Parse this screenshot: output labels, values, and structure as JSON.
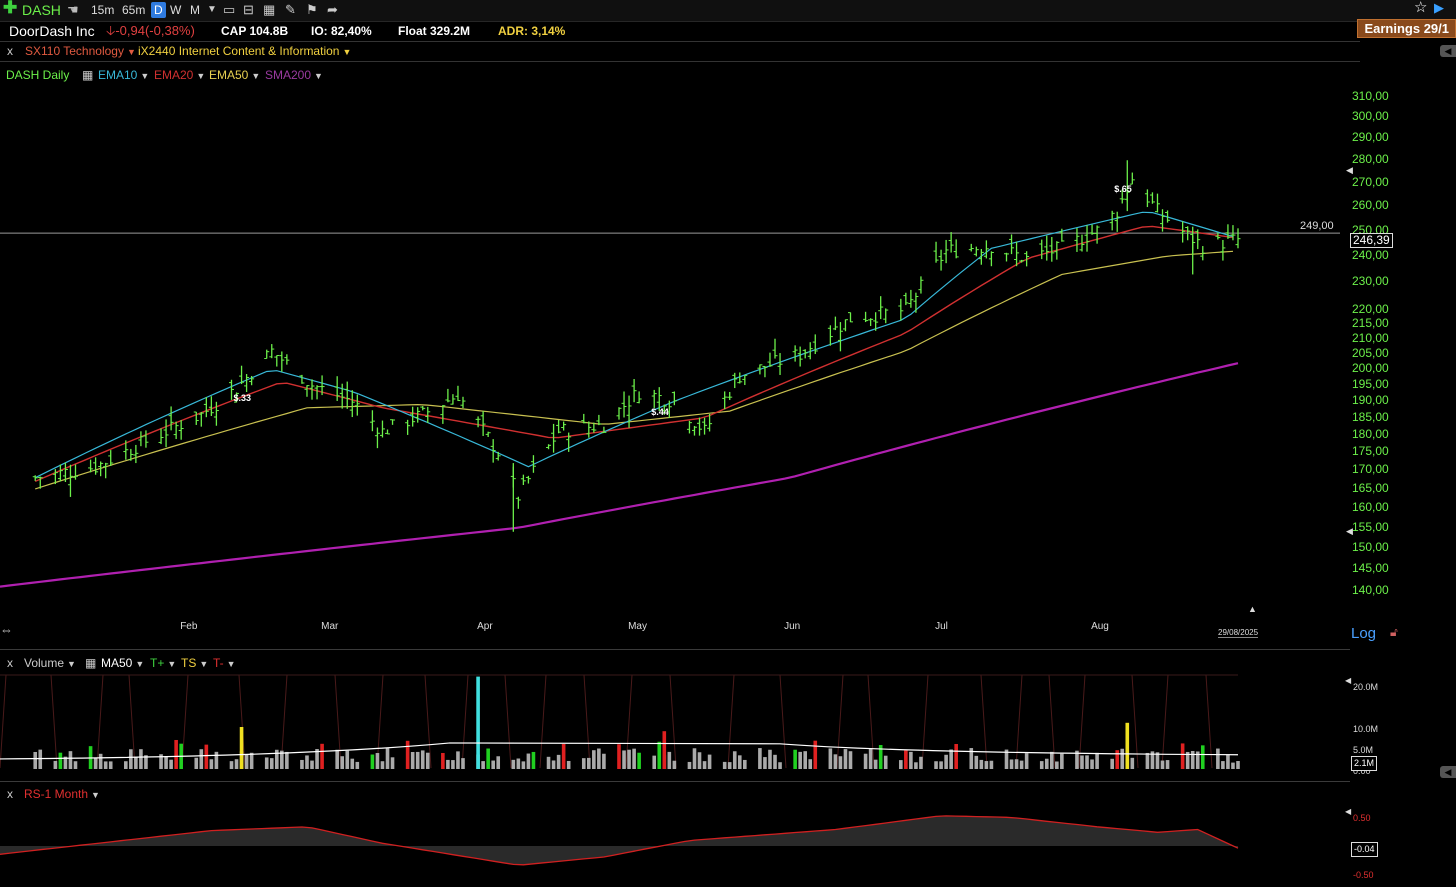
{
  "toolbar": {
    "symbol": "DASH",
    "intervals": [
      "15m",
      "65m",
      "D",
      "W",
      "M"
    ],
    "earnings": "Earnings 29/1"
  },
  "info": {
    "name": "DoorDash Inc",
    "change": "-0,94(-0,38%)",
    "cap": "CAP 104.8B",
    "io": "IO: 82,40%",
    "float": "Float 329.2M",
    "adr": "ADR: 3,14%"
  },
  "sector": {
    "close": "x",
    "sector": "SX110 Technology",
    "industry": "iX2440 Internet Content & Information"
  },
  "indicators": {
    "main": "DASH Daily",
    "ema10": "EMA10",
    "ema20": "EMA20",
    "ema50": "EMA50",
    "sma200": "SMA200"
  },
  "colors": {
    "bars": "#6cf04a",
    "ema10": "#38b8d8",
    "ema20": "#d03030",
    "ema50": "#c8c050",
    "sma200": "#b020b0",
    "rs": "#d02020"
  },
  "volume_panel": {
    "close": "x",
    "label": "Volume",
    "ma": "MA50",
    "tplus": "T+",
    "ts": "TS",
    "tminus": "T-",
    "current": "2.1M",
    "axis": [
      "20.0M",
      "10.0M",
      "5.0M",
      "0.00"
    ]
  },
  "rs_panel": {
    "close": "x",
    "label": "RS-1 Month",
    "current": "-0.04",
    "axis": [
      "0.50",
      "-0.50"
    ]
  },
  "axis_labels": {
    "log": "Log",
    "date_end": "29/08/2025"
  },
  "chart_data": {
    "type": "ohlc",
    "title": "DASH Daily",
    "scale": "log",
    "ylim": [
      138,
      315
    ],
    "y_ticks": [
      310,
      300,
      290,
      280,
      270,
      260,
      250,
      240,
      230,
      220,
      215,
      210,
      205,
      200,
      195,
      190,
      185,
      180,
      175,
      170,
      165,
      160,
      155,
      150,
      145,
      140
    ],
    "x_months": [
      "Feb",
      "Mar",
      "Apr",
      "May",
      "Jun",
      "Jul",
      "Aug"
    ],
    "last_price": "246,39",
    "level": 249,
    "level_label": "249,00",
    "earnings_labels": [
      {
        "date": "2025-02-12",
        "label": "$.33"
      },
      {
        "date": "2025-05-06",
        "label": "$.44"
      },
      {
        "date": "2025-08-06",
        "label": "$.65"
      }
    ],
    "close_anchors": [
      [
        "2025-01-02",
        168
      ],
      [
        "2025-01-14",
        171
      ],
      [
        "2025-02-04",
        186
      ],
      [
        "2025-02-11",
        194
      ],
      [
        "2025-02-18",
        206
      ],
      [
        "2025-02-26",
        195
      ],
      [
        "2025-03-06",
        190
      ],
      [
        "2025-03-12",
        181
      ],
      [
        "2025-03-20",
        186
      ],
      [
        "2025-03-27",
        192
      ],
      [
        "2025-04-04",
        175
      ],
      [
        "2025-04-08",
        163
      ],
      [
        "2025-04-16",
        181
      ],
      [
        "2025-04-25",
        183
      ],
      [
        "2025-05-02",
        193
      ],
      [
        "2025-05-09",
        190
      ],
      [
        "2025-05-15",
        181
      ],
      [
        "2025-05-22",
        198
      ],
      [
        "2025-06-03",
        205
      ],
      [
        "2025-06-13",
        217
      ],
      [
        "2025-06-24",
        220
      ],
      [
        "2025-07-02",
        242
      ],
      [
        "2025-07-11",
        244
      ],
      [
        "2025-07-18",
        239
      ],
      [
        "2025-07-25",
        243
      ],
      [
        "2025-08-01",
        250
      ],
      [
        "2025-08-05",
        258
      ],
      [
        "2025-08-08",
        272
      ],
      [
        "2025-08-13",
        258
      ],
      [
        "2025-08-19",
        248
      ],
      [
        "2025-08-22",
        244
      ],
      [
        "2025-08-29",
        246.39
      ]
    ],
    "sma200_anchors": [
      [
        "2024-12-26",
        141
      ],
      [
        "2025-04-08",
        155
      ],
      [
        "2025-06-01",
        168
      ],
      [
        "2025-08-29",
        202
      ]
    ],
    "ema10_anchors": [
      [
        "2025-01-02",
        168
      ],
      [
        "2025-02-18",
        200
      ],
      [
        "2025-03-06",
        193
      ],
      [
        "2025-04-10",
        171
      ],
      [
        "2025-05-09",
        190
      ],
      [
        "2025-06-24",
        217
      ],
      [
        "2025-07-11",
        243
      ],
      [
        "2025-08-11",
        258
      ],
      [
        "2025-08-29",
        247
      ]
    ],
    "ema20_anchors": [
      [
        "2025-01-02",
        167
      ],
      [
        "2025-02-20",
        196
      ],
      [
        "2025-03-12",
        188
      ],
      [
        "2025-04-15",
        179
      ],
      [
        "2025-05-15",
        185
      ],
      [
        "2025-06-24",
        212
      ],
      [
        "2025-07-18",
        239
      ],
      [
        "2025-08-11",
        252
      ],
      [
        "2025-08-29",
        247
      ]
    ],
    "ema50_anchors": [
      [
        "2025-01-02",
        165
      ],
      [
        "2025-02-25",
        188
      ],
      [
        "2025-03-20",
        189
      ],
      [
        "2025-04-25",
        183
      ],
      [
        "2025-05-20",
        187
      ],
      [
        "2025-06-24",
        206
      ],
      [
        "2025-07-25",
        233
      ],
      [
        "2025-08-15",
        240
      ],
      [
        "2025-08-29",
        242
      ]
    ],
    "volume_ma": 2.6,
    "rs_anchors": [
      [
        "2024-12-26",
        -0.15
      ],
      [
        "2025-02-06",
        0.28
      ],
      [
        "2025-02-25",
        0.35
      ],
      [
        "2025-03-12",
        0.05
      ],
      [
        "2025-04-08",
        -0.35
      ],
      [
        "2025-04-25",
        -0.2
      ],
      [
        "2025-05-12",
        0.1
      ],
      [
        "2025-06-10",
        0.3
      ],
      [
        "2025-07-01",
        0.55
      ],
      [
        "2025-07-15",
        0.52
      ],
      [
        "2025-08-01",
        0.35
      ],
      [
        "2025-08-13",
        0.25
      ],
      [
        "2025-08-21",
        0.3
      ],
      [
        "2025-08-29",
        -0.04
      ]
    ]
  }
}
